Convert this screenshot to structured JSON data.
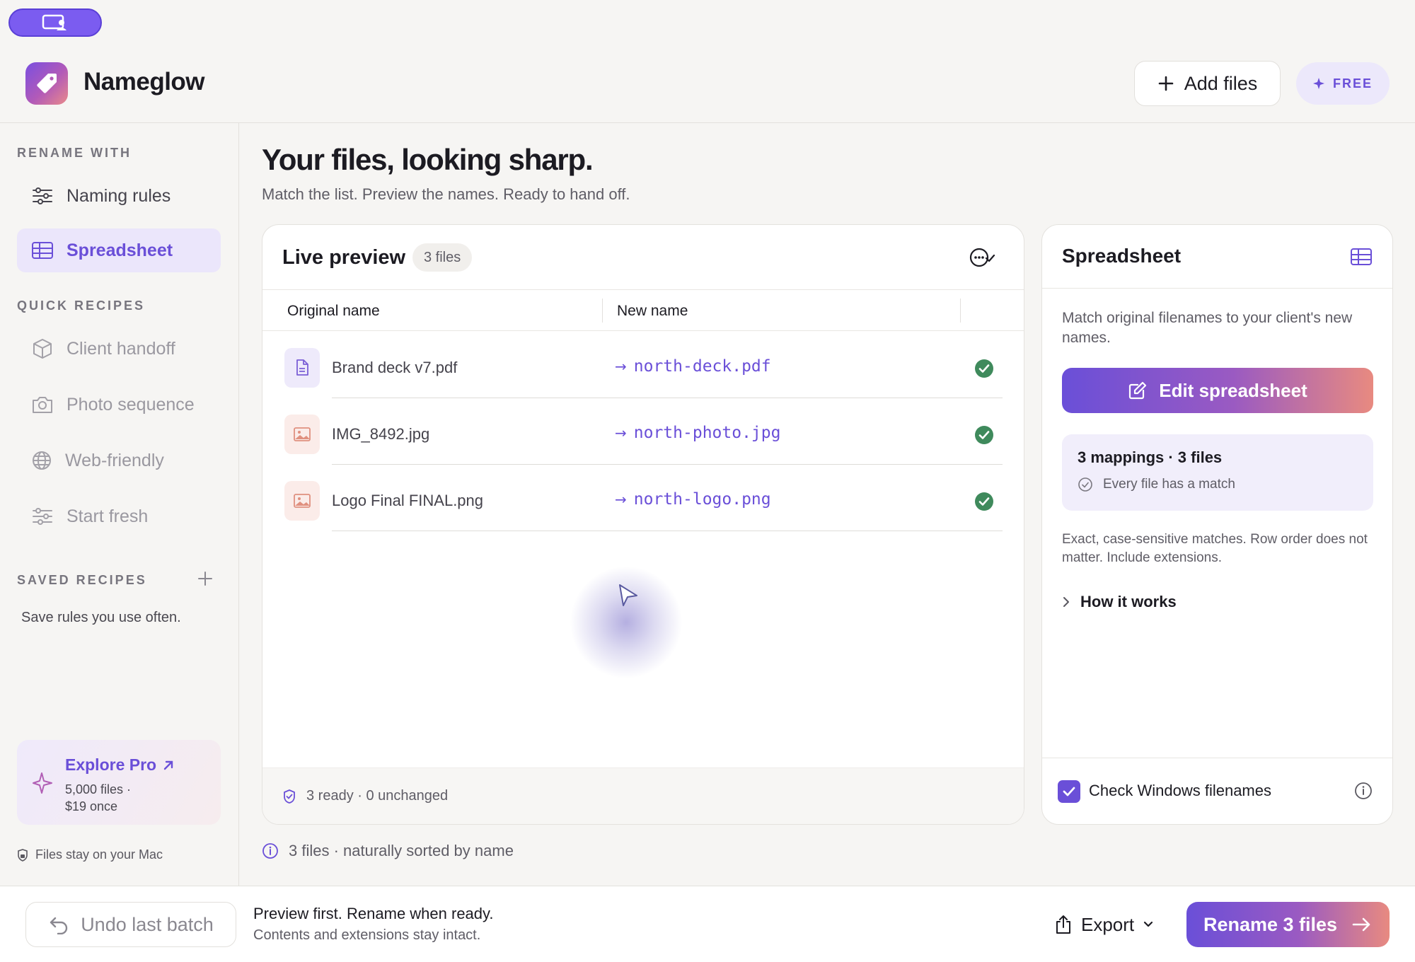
{
  "app": {
    "name": "Nameglow"
  },
  "header": {
    "add_files_label": "Add files",
    "plan_badge": "FREE"
  },
  "sidebar": {
    "section_rename": "RENAME WITH",
    "rename_items": [
      {
        "label": "Naming rules",
        "icon": "sliders-icon",
        "active": false
      },
      {
        "label": "Spreadsheet",
        "icon": "table-icon",
        "active": true
      }
    ],
    "section_recipes": "QUICK RECIPES",
    "recipes": [
      {
        "label": "Client handoff",
        "icon": "box-icon"
      },
      {
        "label": "Photo sequence",
        "icon": "camera-icon"
      },
      {
        "label": "Web-friendly",
        "icon": "globe-icon"
      },
      {
        "label": "Start fresh",
        "icon": "sliders-icon"
      }
    ],
    "section_saved": "SAVED RECIPES",
    "saved_hint": "Save rules you use often.",
    "pro": {
      "title": "Explore Pro",
      "line1": "5,000 files ·",
      "line2": "$19 once"
    },
    "local_note": "Files stay on your Mac"
  },
  "main": {
    "title": "Your files, looking sharp.",
    "subtitle": "Match the list. Preview the names. Ready to hand off.",
    "preview": {
      "title": "Live preview",
      "count_badge": "3 files",
      "col_original": "Original name",
      "col_new": "New name",
      "rows": [
        {
          "original": "Brand deck v7.pdf",
          "new": "north-deck.pdf",
          "type": "doc"
        },
        {
          "original": "IMG_8492.jpg",
          "new": "north-photo.jpg",
          "type": "img"
        },
        {
          "original": "Logo Final FINAL.png",
          "new": "north-logo.png",
          "type": "img"
        }
      ],
      "footer": "3 ready · 0 unchanged"
    },
    "sort_note": "3 files · naturally sorted by name"
  },
  "spreadsheet_panel": {
    "title": "Spreadsheet",
    "description": "Match original filenames to your client's new names.",
    "edit_button": "Edit spreadsheet",
    "mapping_title": "3 mappings · 3 files",
    "mapping_status": "Every file has a match",
    "note": "Exact, case-sensitive matches. Row order does not matter. Include extensions.",
    "how_link": "How it works",
    "windows_check_label": "Check Windows filenames",
    "windows_check_checked": true
  },
  "bottom_bar": {
    "undo_label": "Undo last batch",
    "title": "Preview first. Rename when ready.",
    "subtitle": "Contents and extensions stay intact.",
    "export_label": "Export",
    "rename_label": "Rename 3 files"
  },
  "colors": {
    "accent": "#6a4fd8",
    "gradient_end": "#e88a80",
    "success": "#3f8a5c"
  }
}
